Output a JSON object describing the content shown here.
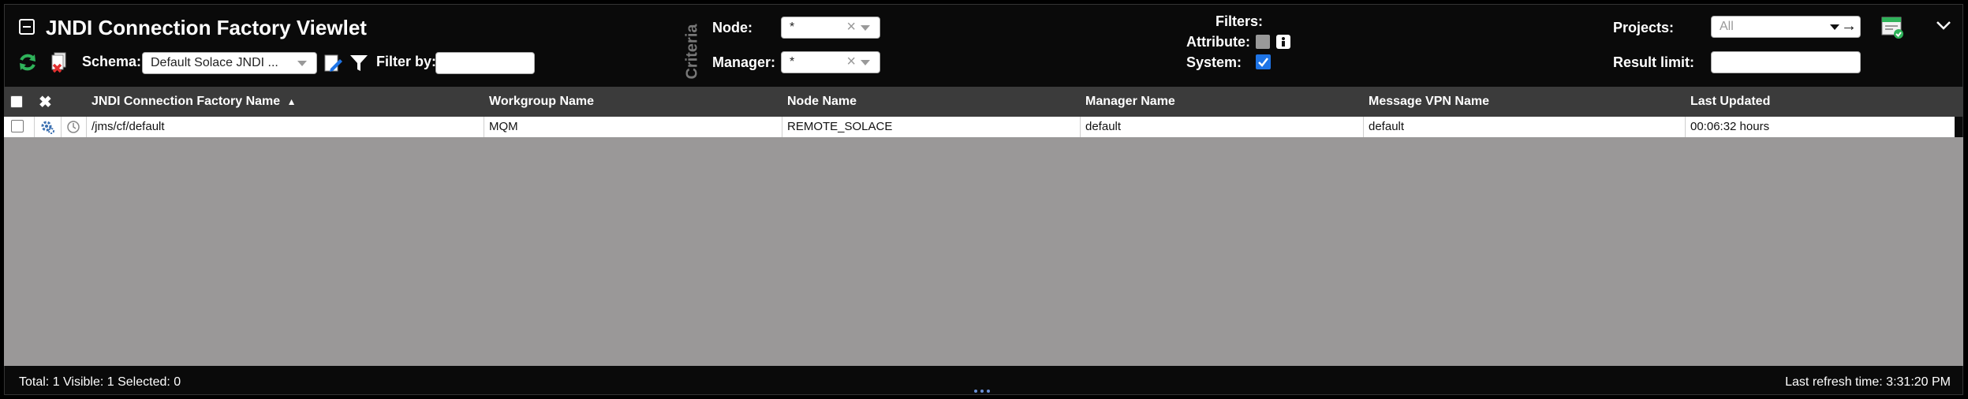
{
  "header": {
    "title": "JNDI Connection Factory Viewlet",
    "schema_label": "Schema:",
    "schema_value": "Default Solace JNDI ...",
    "filter_by_label": "Filter by:",
    "filter_by_value": ""
  },
  "criteria": {
    "label": "Criteria",
    "node_label": "Node:",
    "node_value": "*",
    "manager_label": "Manager:",
    "manager_value": "*"
  },
  "filters": {
    "label": "Filters:",
    "attribute_label": "Attribute:",
    "system_label": "System:",
    "system_checked": true
  },
  "projects": {
    "label": "Projects:",
    "placeholder": "All",
    "result_limit_label": "Result limit:",
    "result_limit_value": ""
  },
  "grid": {
    "columns": [
      "JNDI Connection Factory Name",
      "Workgroup Name",
      "Node Name",
      "Manager Name",
      "Message VPN Name",
      "Last Updated"
    ],
    "sort_column": "JNDI Connection Factory Name",
    "sort_direction": "ascending",
    "rows": [
      {
        "name": "/jms/cf/default",
        "workgroup": "MQM",
        "node": "REMOTE_SOLACE",
        "manager": "default",
        "vpn": "default",
        "updated": "00:06:32 hours"
      }
    ]
  },
  "footer": {
    "counts": "Total: 1 Visible: 1 Selected: 0",
    "refresh": "Last refresh time: 3:31:20 PM"
  },
  "colors": {
    "accent_green": "#2fb35a",
    "accent_red": "#e23030",
    "checkbox_blue": "#1e74e6",
    "grid_body": "#9a9898",
    "grid_header": "#3b3b3b"
  },
  "icons": {
    "collapse": "collapse-icon",
    "refresh": "refresh-icon",
    "delete": "delete-icon",
    "edit_schema": "edit-schema-icon",
    "filter": "filter-icon",
    "info": "info-icon",
    "dashboard": "dashboard-icon",
    "chevron": "chevron-down-icon",
    "settings": "gear-icon",
    "clock": "clock-icon"
  }
}
